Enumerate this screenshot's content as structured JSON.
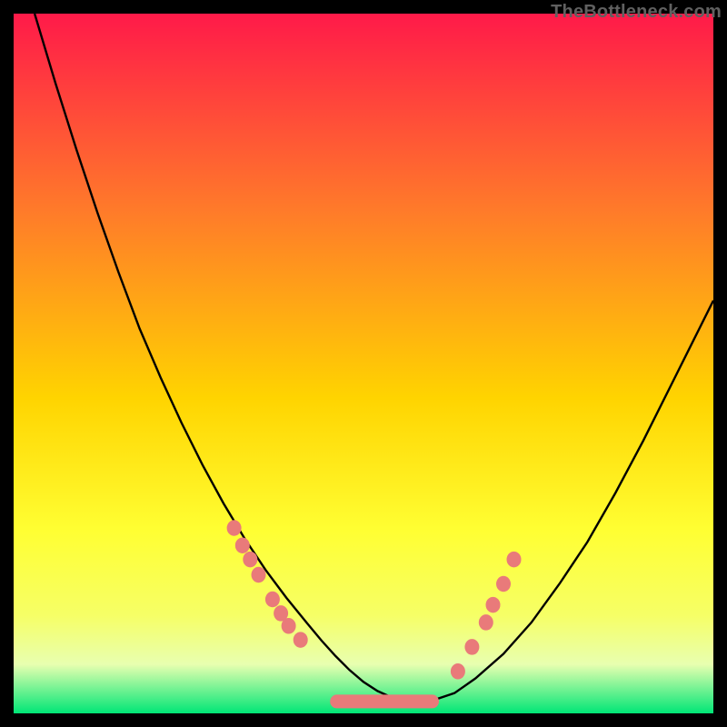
{
  "watermark": "TheBottleneck.com",
  "colors": {
    "gradient_top": "#ff1a49",
    "gradient_mid1": "#ff7a2a",
    "gradient_mid2": "#ffd400",
    "gradient_mid3": "#ffff33",
    "gradient_mid4": "#f6ff66",
    "gradient_bottom_band": "#e8ffb0",
    "gradient_lowest": "#00e676",
    "curve_stroke": "#000000",
    "marker_fill": "#e97a7a",
    "marker_stroke": "#e97a7a"
  },
  "chart_data": {
    "type": "line",
    "title": "",
    "xlabel": "",
    "ylabel": "",
    "xlim": [
      0,
      100
    ],
    "ylim": [
      0,
      100
    ],
    "series": [
      {
        "name": "bottleneck-curve",
        "x": [
          3,
          6,
          9,
          12,
          15,
          18,
          21,
          24,
          27,
          30,
          33,
          36,
          39,
          42,
          44,
          46,
          48,
          50,
          52,
          54,
          56,
          58,
          60,
          63,
          66,
          70,
          74,
          78,
          82,
          86,
          90,
          94,
          98,
          100
        ],
        "y": [
          100,
          90,
          80.5,
          71.5,
          63,
          55,
          48,
          41.5,
          35.5,
          30,
          25,
          20.5,
          16.5,
          12.8,
          10.4,
          8.2,
          6.2,
          4.5,
          3.2,
          2.3,
          1.8,
          1.7,
          1.9,
          2.9,
          5,
          8.5,
          13,
          18.5,
          24.5,
          31.5,
          39,
          47,
          55,
          59
        ]
      }
    ],
    "markers_left": [
      {
        "x": 31.5,
        "y": 26.5
      },
      {
        "x": 32.7,
        "y": 24.0
      },
      {
        "x": 33.8,
        "y": 22.0
      },
      {
        "x": 35.0,
        "y": 19.8
      },
      {
        "x": 37.0,
        "y": 16.3
      },
      {
        "x": 38.2,
        "y": 14.3
      },
      {
        "x": 39.3,
        "y": 12.5
      },
      {
        "x": 41.0,
        "y": 10.5
      }
    ],
    "markers_bottom": [
      {
        "x": 46.0,
        "y": 2.0
      },
      {
        "x": 48.0,
        "y": 1.8
      },
      {
        "x": 50.0,
        "y": 1.7
      },
      {
        "x": 52.0,
        "y": 1.7
      },
      {
        "x": 54.0,
        "y": 1.7
      },
      {
        "x": 56.0,
        "y": 1.8
      },
      {
        "x": 58.0,
        "y": 1.9
      },
      {
        "x": 60.0,
        "y": 2.0
      }
    ],
    "markers_right": [
      {
        "x": 63.5,
        "y": 6.0
      },
      {
        "x": 65.5,
        "y": 9.5
      },
      {
        "x": 67.5,
        "y": 13.0
      },
      {
        "x": 68.5,
        "y": 15.5
      },
      {
        "x": 70.0,
        "y": 18.5
      },
      {
        "x": 71.5,
        "y": 22.0
      }
    ]
  }
}
